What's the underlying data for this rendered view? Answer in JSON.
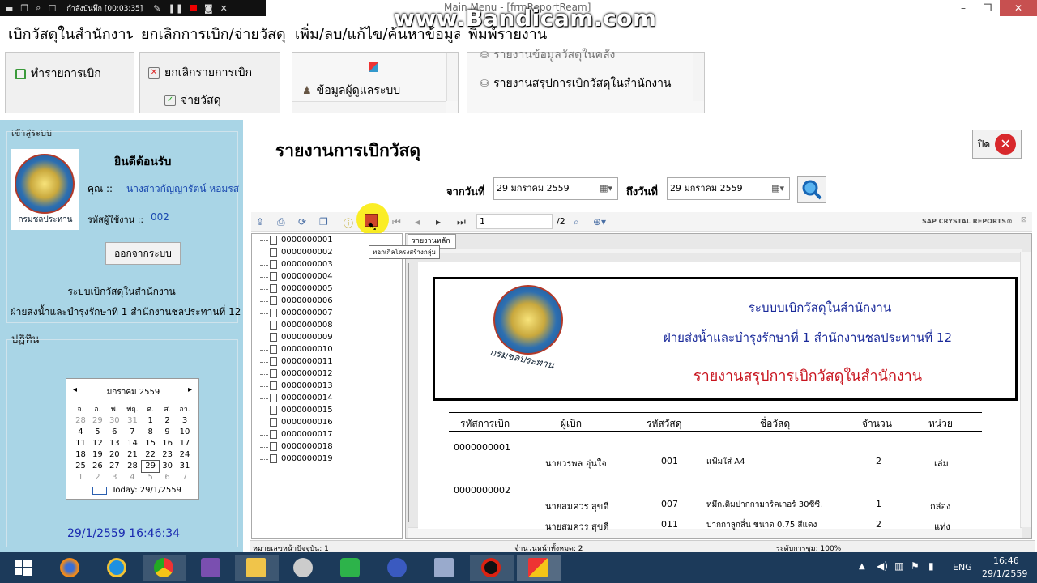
{
  "recorder": {
    "status": "กำลังบันทึก [00:03:35]",
    "watermark": "www.Bandicam.com"
  },
  "window": {
    "title": "Main Menu - [frmReportReam]",
    "controls": [
      "–",
      "❐",
      "✕"
    ]
  },
  "ribbon": {
    "tabs": [
      "เบิกวัสดุในสำนักงาน",
      "ยกเลิกการเบิก/จ่ายวัสดุ",
      "เพิ่ม/ลบ/แก้ไข/ค้นหาข้อมูล",
      "พิมพ์รายงาน"
    ],
    "group1": {
      "item": "ทำรายการเบิก"
    },
    "group2": {
      "items": [
        "ยกเลิกรายการเบิก",
        "จ่ายวัสดุ"
      ]
    },
    "group3": {
      "item": "ข้อมูลผู้ดูแลระบบ"
    },
    "group4": {
      "items": [
        "รายงานข้อมูลวัสดุในคลัง",
        "รายงานสรุปการเบิกวัสดุในสำนักงาน"
      ]
    }
  },
  "login": {
    "legend": "เข้าสู่ระบบ",
    "welcome": "ยินดีต้อนรับ",
    "user_label": "คุณ ::",
    "user_name": "นางสาวกัญญารัตน์  หอมรส",
    "id_label": "รหัสผู้ใช้งาน ::",
    "id_value": "002",
    "logout": "ออกจากระบบ",
    "logo_text": "กรมชลประทาน",
    "system_name": "ระบบเบิกวัสดุในสำนักงาน",
    "department": "ฝ่ายส่งน้ำและบำรุงรักษาที่ 1 สำนักงานชลประทานที่ 12"
  },
  "calendar": {
    "legend": "ปฏิทิน",
    "month": "มกราคม 2559",
    "weekdays": [
      "จ.",
      "อ.",
      "พ.",
      "พฤ.",
      "ศ.",
      "ส.",
      "อา."
    ],
    "weeks": [
      [
        "28",
        "29",
        "30",
        "31",
        "1",
        "2",
        "3"
      ],
      [
        "4",
        "5",
        "6",
        "7",
        "8",
        "9",
        "10"
      ],
      [
        "11",
        "12",
        "13",
        "14",
        "15",
        "16",
        "17"
      ],
      [
        "18",
        "19",
        "20",
        "21",
        "22",
        "23",
        "24"
      ],
      [
        "25",
        "26",
        "27",
        "28",
        "29",
        "30",
        "31"
      ],
      [
        "1",
        "2",
        "3",
        "4",
        "5",
        "6",
        "7"
      ]
    ],
    "today": "Today: 29/1/2559",
    "datetime": "29/1/2559 16:46:34"
  },
  "report_header": {
    "title": "รายงานการเบิกวัสดุ",
    "close_label": "ปิด",
    "from_label": "จากวันที่",
    "from_value": "29  มกราคม      2559",
    "to_label": "ถึงวันที่",
    "to_value": "29  มกราคม      2559"
  },
  "viewer": {
    "page_input": "1",
    "page_total": "/2",
    "brand": "SAP CRYSTAL REPORTS®",
    "tab": "รายงานหลัก",
    "tooltip": "ทอกเกิลโครงสร้างกลุ่ม",
    "tree_items": [
      "0000000001",
      "0000000002",
      "0000000003",
      "0000000004",
      "0000000005",
      "0000000006",
      "0000000007",
      "0000000008",
      "0000000009",
      "0000000010",
      "0000000011",
      "0000000012",
      "0000000013",
      "0000000014",
      "0000000015",
      "0000000016",
      "0000000017",
      "0000000018",
      "0000000019"
    ],
    "status_current": "หมายเลขหน้าปัจจุบัน: 1",
    "status_total": "จำนวนหน้าทั้งหมด: 2",
    "status_zoom": "ระดับการซูม: 100%"
  },
  "report": {
    "org_line1": "ระบบบเบิกวัสดุในสำนักงาน",
    "org_line2": "ฝ่ายส่งน้ำและบำรุงรักษาที่ 1 สำนักงานชลประทานที่ 12",
    "title": "รายงานสรุปการเบิกวัสดุในสำนักงาน",
    "logo_text": "กรมชลประทาน",
    "columns": [
      "รหัสการเบิก",
      "ผู้เบิก",
      "รหัสวัสดุ",
      "ชื่อวัสดุ",
      "จำนวน",
      "หน่วย"
    ],
    "groups": [
      {
        "code": "0000000001",
        "rows": [
          [
            "นายวรพล  อุ่นใจ",
            "001",
            "แฟ้มใส่ A4",
            "2",
            "เล่ม"
          ]
        ]
      },
      {
        "code": "0000000002",
        "rows": [
          [
            "นายสมควร สุขดี",
            "007",
            "หมึกเติมปากกามาร์คเกอร์ 30ซีซี.",
            "1",
            "กล่อง"
          ],
          [
            "นายสมควร สุขดี",
            "011",
            "ปากกาลูกลื่น ขนาด 0.75 สีแดง",
            "2",
            "แท่ง"
          ]
        ]
      }
    ]
  },
  "taskbar": {
    "lang": "ENG",
    "time": "16:46",
    "date": "29/1/2559"
  }
}
